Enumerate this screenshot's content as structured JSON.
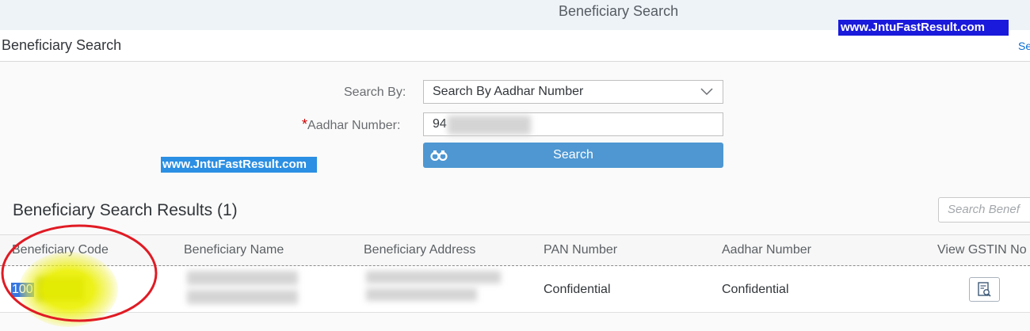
{
  "topbar": {
    "title": "Beneficiary Search"
  },
  "watermarks": {
    "top": "www.JntuFastResult.com",
    "middle": "www.JntuFastResult.com"
  },
  "subheader": {
    "title": "Beneficiary Search",
    "link_text": "Se"
  },
  "form": {
    "search_by_label": "Search By:",
    "search_by_value": "Search By Aadhar Number",
    "required_marker": "*",
    "aadhar_label": "Aadhar Number:",
    "aadhar_value_visible": "94",
    "search_button_label": "Search"
  },
  "results": {
    "title": "Beneficiary Search Results (1)",
    "search_placeholder": "Search Benef",
    "columns": [
      "Beneficiary Code",
      "Beneficiary Name",
      "Beneficiary Address",
      "PAN Number",
      "Aadhar Number",
      "View GSTIN No"
    ],
    "rows": [
      {
        "code_visible": "100",
        "pan": "Confidential",
        "aadhar": "Confidential"
      }
    ]
  },
  "icons": {
    "dropdown": "chevron-down-icon",
    "search": "binoculars-icon",
    "view": "document-search-icon"
  },
  "colors": {
    "accent": "#4e97d2",
    "link": "#0a6ed1",
    "required": "#cc0000",
    "annotation_circle": "#e01b24",
    "annotation_highlight": "#ebf000"
  }
}
